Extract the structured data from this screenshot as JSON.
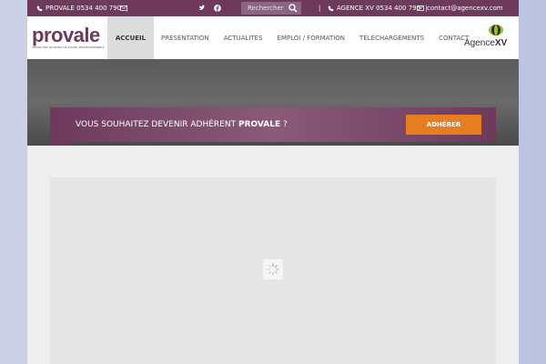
{
  "topbar": {
    "phone1": "PROVALE 0534 400 790",
    "sep": "|",
    "search_placeholder": "Rechercher",
    "phone2": "AGENCE XV 0534 400 790",
    "email2": "contact@agencexv.com"
  },
  "logo": {
    "text": "provale",
    "subtitle": "UNION DES JOUEURS DE RUGBY PROFESSIONNELS"
  },
  "nav": {
    "items": [
      "ACCUEIL",
      "PRÉSENTATION",
      "ACTUALITÉS",
      "EMPLOI / FORMATION",
      "TÉLÉCHARGEMENTS",
      "CONTACT"
    ]
  },
  "agence": {
    "prefix": "Agence",
    "suffix": "XV"
  },
  "banner": {
    "text": "VOUS SOUHAITEZ DEVENIR ADHÉRENT",
    "brand": "PROVALE",
    "question": "?",
    "button": "ADHÉRER"
  },
  "colors": {
    "brand": "#6e3a5c",
    "accent": "#e67d21"
  }
}
